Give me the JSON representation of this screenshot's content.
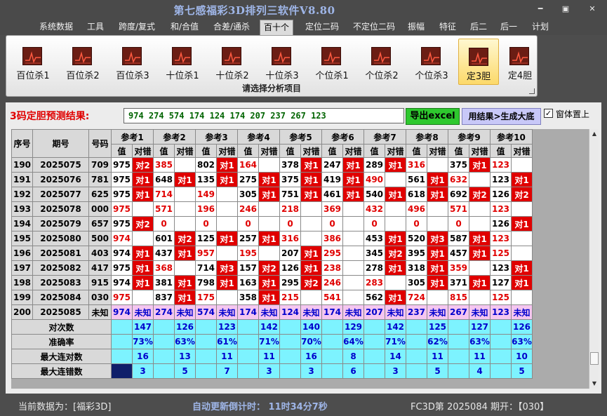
{
  "app": {
    "title": "第七感福彩3D排列三软件V8.80",
    "window_buttons": {
      "minimize": "━",
      "restore": "▣",
      "close": "✕"
    }
  },
  "menu": [
    "系统数据",
    "工具",
    "跨度/复式",
    "和/合值",
    "合差/通杀",
    "百十个",
    "定位二码",
    "不定位二码",
    "振幅",
    "特征",
    "后二",
    "后一",
    "计划"
  ],
  "menu_active": "百十个",
  "ribbon": {
    "buttons": [
      "百位杀1",
      "百位杀2",
      "百位杀3",
      "十位杀1",
      "十位杀2",
      "十位杀3",
      "个位杀1",
      "个位杀2",
      "个位杀3",
      "定3胆",
      "定4胆"
    ],
    "selected": "定3胆",
    "caption": "请选择分析项目",
    "icon": "chart-icon"
  },
  "prediction": {
    "label": "3码定胆预测结果:",
    "value": "974 274 574 174 124 174 207 237 267 123"
  },
  "buttons": {
    "export": "导出excel",
    "generate": "用结果>生成大底"
  },
  "topmost": {
    "checked": true,
    "mark": "✓",
    "label": "窗体置上"
  },
  "grid": {
    "headers": {
      "seq": "序号",
      "issue": "期号",
      "number": "号码",
      "value": "值",
      "hit": "对错"
    },
    "refs": [
      "参考1",
      "参考2",
      "参考3",
      "参考4",
      "参考5",
      "参考6",
      "参考7",
      "参考8",
      "参考9",
      "参考10"
    ],
    "rows": [
      {
        "seq": "190",
        "issue": "2025075",
        "num": "709",
        "cells": [
          [
            "975",
            "对2"
          ],
          [
            "385",
            ""
          ],
          [
            "802",
            "对1"
          ],
          [
            "164",
            ""
          ],
          [
            "378",
            "对1"
          ],
          [
            "247",
            "对1"
          ],
          [
            "289",
            "对1"
          ],
          [
            "316",
            ""
          ],
          [
            "375",
            "对1"
          ],
          [
            "123",
            ""
          ]
        ]
      },
      {
        "seq": "191",
        "issue": "2025076",
        "num": "781",
        "cells": [
          [
            "975",
            "对1"
          ],
          [
            "648",
            "对1"
          ],
          [
            "135",
            "对1"
          ],
          [
            "275",
            "对1"
          ],
          [
            "375",
            "对1"
          ],
          [
            "419",
            "对1"
          ],
          [
            "490",
            ""
          ],
          [
            "561",
            "对1"
          ],
          [
            "632",
            ""
          ],
          [
            "123",
            "对1"
          ]
        ]
      },
      {
        "seq": "192",
        "issue": "2025077",
        "num": "625",
        "cells": [
          [
            "975",
            "对1"
          ],
          [
            "714",
            ""
          ],
          [
            "149",
            ""
          ],
          [
            "305",
            "对1"
          ],
          [
            "751",
            "对1"
          ],
          [
            "461",
            "对1"
          ],
          [
            "540",
            "对1"
          ],
          [
            "618",
            "对1"
          ],
          [
            "692",
            "对2"
          ],
          [
            "126",
            "对2"
          ]
        ]
      },
      {
        "seq": "193",
        "issue": "2025078",
        "num": "000",
        "cells": [
          [
            "975",
            ""
          ],
          [
            "571",
            ""
          ],
          [
            "196",
            ""
          ],
          [
            "246",
            ""
          ],
          [
            "218",
            ""
          ],
          [
            "369",
            ""
          ],
          [
            "432",
            ""
          ],
          [
            "496",
            ""
          ],
          [
            "571",
            ""
          ],
          [
            "123",
            ""
          ]
        ]
      },
      {
        "seq": "194",
        "issue": "2025079",
        "num": "657",
        "cells": [
          [
            "975",
            "对2"
          ],
          [
            "0",
            ""
          ],
          [
            "0",
            ""
          ],
          [
            "0",
            ""
          ],
          [
            "0",
            ""
          ],
          [
            "0",
            ""
          ],
          [
            "0",
            ""
          ],
          [
            "0",
            ""
          ],
          [
            "0",
            ""
          ],
          [
            "126",
            "对1"
          ]
        ]
      },
      {
        "seq": "195",
        "issue": "2025080",
        "num": "500",
        "cells": [
          [
            "974",
            ""
          ],
          [
            "601",
            "对2"
          ],
          [
            "125",
            "对1"
          ],
          [
            "257",
            "对1"
          ],
          [
            "316",
            ""
          ],
          [
            "386",
            ""
          ],
          [
            "453",
            "对1"
          ],
          [
            "520",
            "对3"
          ],
          [
            "587",
            "对1"
          ],
          [
            "123",
            ""
          ]
        ]
      },
      {
        "seq": "196",
        "issue": "2025081",
        "num": "403",
        "cells": [
          [
            "974",
            "对1"
          ],
          [
            "437",
            "对1"
          ],
          [
            "957",
            ""
          ],
          [
            "195",
            ""
          ],
          [
            "207",
            "对1"
          ],
          [
            "295",
            ""
          ],
          [
            "345",
            "对2"
          ],
          [
            "395",
            "对1"
          ],
          [
            "457",
            "对1"
          ],
          [
            "125",
            ""
          ]
        ]
      },
      {
        "seq": "197",
        "issue": "2025082",
        "num": "417",
        "cells": [
          [
            "975",
            "对1"
          ],
          [
            "368",
            ""
          ],
          [
            "714",
            "对3"
          ],
          [
            "157",
            "对2"
          ],
          [
            "126",
            "对1"
          ],
          [
            "238",
            ""
          ],
          [
            "278",
            "对1"
          ],
          [
            "318",
            "对1"
          ],
          [
            "359",
            ""
          ],
          [
            "123",
            "对1"
          ]
        ]
      },
      {
        "seq": "198",
        "issue": "2025083",
        "num": "915",
        "cells": [
          [
            "974",
            "对1"
          ],
          [
            "381",
            "对1"
          ],
          [
            "798",
            "对1"
          ],
          [
            "163",
            "对1"
          ],
          [
            "295",
            "对2"
          ],
          [
            "246",
            ""
          ],
          [
            "283",
            ""
          ],
          [
            "305",
            "对1"
          ],
          [
            "371",
            "对1"
          ],
          [
            "127",
            "对1"
          ]
        ]
      },
      {
        "seq": "199",
        "issue": "2025084",
        "num": "030",
        "cells": [
          [
            "975",
            ""
          ],
          [
            "837",
            "对1"
          ],
          [
            "175",
            ""
          ],
          [
            "358",
            "对1"
          ],
          [
            "215",
            ""
          ],
          [
            "541",
            ""
          ],
          [
            "562",
            "对1"
          ],
          [
            "724",
            ""
          ],
          [
            "815",
            ""
          ],
          [
            "125",
            ""
          ]
        ]
      }
    ],
    "unknown_row": {
      "seq": "200",
      "issue": "2025085",
      "num": "未知",
      "unknown": "未知",
      "values": [
        "974",
        "274",
        "574",
        "174",
        "124",
        "174",
        "207",
        "237",
        "267",
        "123"
      ]
    },
    "stats": [
      {
        "label": "对次数",
        "values": [
          "147",
          "126",
          "123",
          "142",
          "140",
          "129",
          "142",
          "125",
          "127",
          "126"
        ]
      },
      {
        "label": "准确率",
        "values": [
          "73%",
          "63%",
          "61%",
          "71%",
          "70%",
          "64%",
          "71%",
          "62%",
          "63%",
          "63%"
        ]
      },
      {
        "label": "最大连对数",
        "values": [
          "16",
          "13",
          "11",
          "11",
          "16",
          "8",
          "14",
          "11",
          "11",
          "10"
        ]
      },
      {
        "label": "最大连错数",
        "values": [
          "3",
          "5",
          "7",
          "3",
          "3",
          "6",
          "3",
          "5",
          "4",
          "5"
        ]
      }
    ]
  },
  "status": {
    "data_source": "当前数据为：[福彩3D]",
    "countdown": "自动更新倒计时： 11时34分7秒",
    "issue": "FC3D第 2025084 期开：【030】"
  },
  "colors": {
    "hit_bg": "#e00000",
    "unknown_row_bg": "#f5c6f0",
    "stats_bg": "#7df3ff",
    "prediction_text": "#006400",
    "export_btn": "#2ec82e",
    "generate_btn": "#c8c8f8"
  }
}
